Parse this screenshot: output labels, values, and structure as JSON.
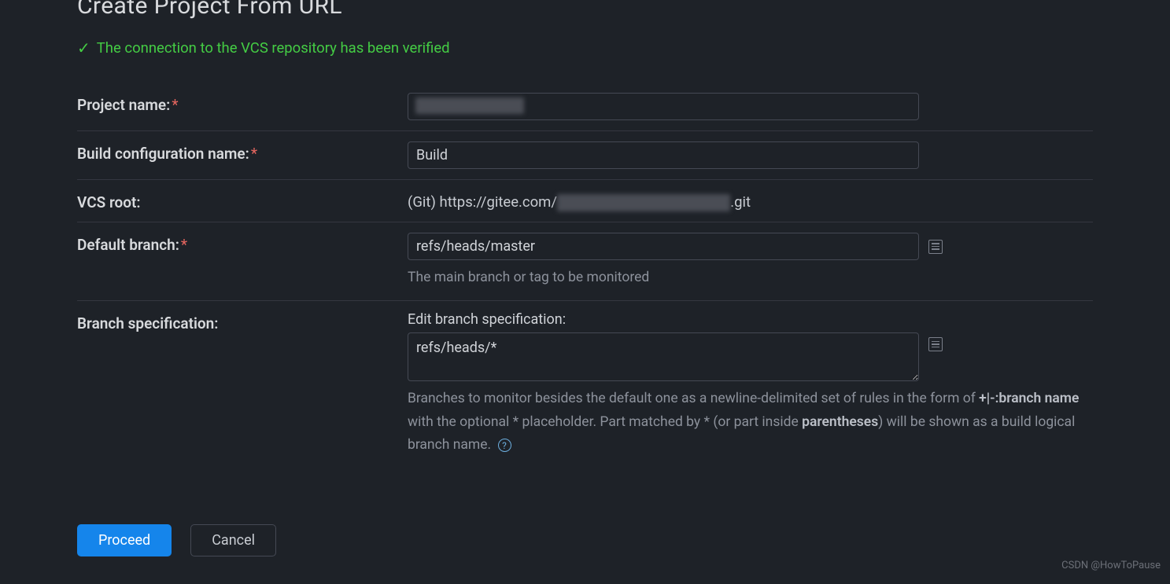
{
  "page": {
    "title": "Create Project From URL"
  },
  "verification": {
    "message": "The connection to the VCS repository has been verified"
  },
  "form": {
    "project_name": {
      "label": "Project name:",
      "value": ""
    },
    "build_config": {
      "label": "Build configuration name:",
      "value": "Build"
    },
    "vcs_root": {
      "label": "VCS root:",
      "prefix": "(Git) https://gitee.com/",
      "suffix": ".git"
    },
    "default_branch": {
      "label": "Default branch:",
      "value": "refs/heads/master",
      "help": "The main branch or tag to be monitored"
    },
    "branch_spec": {
      "label": "Branch specification:",
      "sublabel": "Edit branch specification:",
      "value": "refs/heads/*",
      "help_parts": {
        "p1": "Branches to monitor besides the default one as a newline-delimited set of rules in the form of ",
        "p2": "+|-:branch name",
        "p3": " with the optional * placeholder. Part matched by * (or part inside ",
        "p4": "parentheses",
        "p5": ") will be shown as a build logical branch name. "
      }
    }
  },
  "buttons": {
    "proceed": "Proceed",
    "cancel": "Cancel"
  },
  "watermark": "CSDN @HowToPause"
}
